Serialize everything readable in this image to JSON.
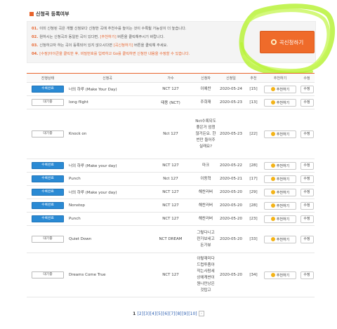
{
  "section_title": "신청곡 등록여부",
  "notice": {
    "line1": {
      "num": "01.",
      "text": "이미 신청된 곡은 개별 신청보다 신청한 곡에 추천수를 높이는 것이 수록될 가능성이 더 높습니다."
    },
    "line2": {
      "num": "02.",
      "pre": "원하시는 신청곡과 동일한 곡이 있다면,",
      "hl": "[추천하기]",
      "post": "버튼을 클릭해주시기 바랍니다."
    },
    "line3": {
      "num": "03.",
      "pre": "신청하고자 하는 곡이 등록되어 있지 않으시다면",
      "hl": "[곡신청하기]",
      "post": "버튼을 클릭해 주세요."
    },
    "line4": {
      "num": "04.",
      "text": "[수정]아이콘을 클릭한 후, 비밀번호를 입력하고 Go를 클릭하면 신청한 내용을 수정할 수 있습니다."
    }
  },
  "apply_button": "곡신청하기",
  "table": {
    "headers": [
      "진행상태",
      "신청곡",
      "가수",
      "신청자",
      "신청일",
      "추천",
      "추천하기",
      "수정"
    ],
    "recommend_label": "추천하기",
    "edit_label": "수정",
    "rows": [
      {
        "status": "수록완료",
        "done": true,
        "song": "너의 하루 (Make Your Day)",
        "artist": "NCT 127",
        "requester": "이예찬",
        "date": "2020-05-24",
        "rec": "[15]"
      },
      {
        "status": "대기중",
        "done": false,
        "song": "long flight",
        "artist": "태용 (NCT)",
        "requester": "주희재",
        "date": "2020-05-23",
        "rec": "[13]"
      },
      {
        "status": "대기중",
        "done": false,
        "song": "Knock on",
        "artist": "Nct 127",
        "requester": "Nct수록되도 좋은거 엄청 많거든요. 한번만 들어주실래요?",
        "date": "2020-05-23",
        "rec": "[22]"
      },
      {
        "status": "수록완료",
        "done": true,
        "song": "너의 하루 (Make your day)",
        "artist": "NCT 127",
        "requester": "마크",
        "date": "2020-05-22",
        "rec": "[28]"
      },
      {
        "status": "수록완료",
        "done": true,
        "song": "Punch",
        "artist": "Nct 127",
        "requester": "이동혁",
        "date": "2020-05-21",
        "rec": "[17]"
      },
      {
        "status": "수록완료",
        "done": true,
        "song": "너의 하루 (Make your day)",
        "artist": "NCT 127",
        "requester": "해찬러버",
        "date": "2020-05-20",
        "rec": "[29]"
      },
      {
        "status": "수록완료",
        "done": true,
        "song": "Nonstop",
        "artist": "NCT 127",
        "requester": "해찬러버",
        "date": "2020-05-20",
        "rec": "[28]"
      },
      {
        "status": "수록완료",
        "done": true,
        "song": "Punch",
        "artist": "NCT 127",
        "requester": "해찬러버",
        "date": "2020-05-20",
        "rec": "[23]"
      },
      {
        "status": "대기중",
        "done": false,
        "song": "Quiet Down",
        "artist": "NCT DREAM",
        "requester": "그렇다니고 란가보네고 돈가뷰",
        "date": "2020-05-20",
        "rec": "[33]"
      },
      {
        "status": "대기중",
        "done": false,
        "song": "Dreams Come True",
        "artist": "NCT 127",
        "requester": "이렇재미다 드렵투줌아 작는사람세 상에캐쌴이 원나만낭은 것탑고",
        "date": "2020-05-20",
        "rec": "[34]"
      }
    ]
  },
  "pagination": {
    "current": "1",
    "pages": [
      "[2]",
      "[3]",
      "[4]",
      "[5]",
      "[6]",
      "[7]",
      "[8]",
      "[9]",
      "[10]"
    ],
    "next_icon": "next-page-icon"
  }
}
